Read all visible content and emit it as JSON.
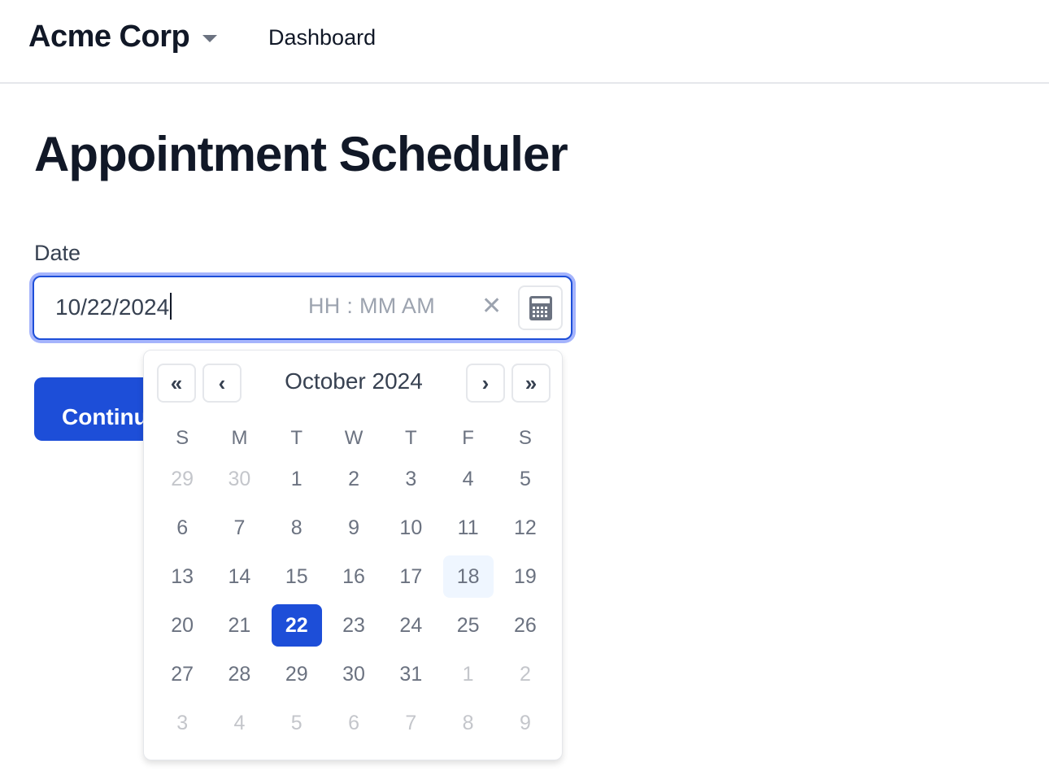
{
  "header": {
    "brand": "Acme Corp",
    "nav": [
      "Dashboard"
    ]
  },
  "page": {
    "title": "Appointment Scheduler"
  },
  "form": {
    "date_label": "Date",
    "date_value": "10/22/2024",
    "time_placeholder": "HH : MM  AM",
    "clear_glyph": "✕",
    "continue_label": "Continue"
  },
  "calendar": {
    "month_title": "October 2024",
    "prev_year_glyph": "«",
    "prev_month_glyph": "‹",
    "next_month_glyph": "›",
    "next_year_glyph": "»",
    "weekdays": [
      "S",
      "M",
      "T",
      "W",
      "T",
      "F",
      "S"
    ],
    "selected_day": "22",
    "today_day": "18",
    "weeks": [
      [
        {
          "d": "29",
          "o": true
        },
        {
          "d": "30",
          "o": true
        },
        {
          "d": "1"
        },
        {
          "d": "2"
        },
        {
          "d": "3"
        },
        {
          "d": "4"
        },
        {
          "d": "5"
        }
      ],
      [
        {
          "d": "6"
        },
        {
          "d": "7"
        },
        {
          "d": "8"
        },
        {
          "d": "9"
        },
        {
          "d": "10"
        },
        {
          "d": "11"
        },
        {
          "d": "12"
        }
      ],
      [
        {
          "d": "13"
        },
        {
          "d": "14"
        },
        {
          "d": "15"
        },
        {
          "d": "16"
        },
        {
          "d": "17"
        },
        {
          "d": "18",
          "today": true
        },
        {
          "d": "19"
        }
      ],
      [
        {
          "d": "20"
        },
        {
          "d": "21"
        },
        {
          "d": "22",
          "selected": true
        },
        {
          "d": "23"
        },
        {
          "d": "24"
        },
        {
          "d": "25"
        },
        {
          "d": "26"
        }
      ],
      [
        {
          "d": "27"
        },
        {
          "d": "28"
        },
        {
          "d": "29"
        },
        {
          "d": "30"
        },
        {
          "d": "31"
        },
        {
          "d": "1",
          "o": true
        },
        {
          "d": "2",
          "o": true
        }
      ],
      [
        {
          "d": "3",
          "o": true
        },
        {
          "d": "4",
          "o": true
        },
        {
          "d": "5",
          "o": true
        },
        {
          "d": "6",
          "o": true
        },
        {
          "d": "7",
          "o": true
        },
        {
          "d": "8",
          "o": true
        },
        {
          "d": "9",
          "o": true
        }
      ]
    ]
  },
  "colors": {
    "accent": "#1d4ed8",
    "today_bg": "#eff6ff",
    "muted_day": "#c4c6cb",
    "day_text": "#6b7280"
  }
}
